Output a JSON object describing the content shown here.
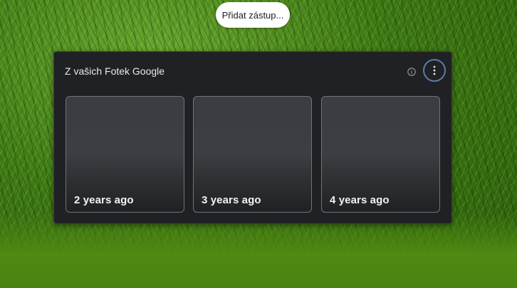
{
  "shortcut": {
    "label": "Přidat zástup..."
  },
  "card": {
    "title": "Z vašich Fotek Google",
    "info_icon": "info-icon",
    "menu_icon": "more-vertical-icon",
    "photos": [
      {
        "label": "2 years ago"
      },
      {
        "label": "3 years ago"
      },
      {
        "label": "4 years ago"
      }
    ]
  },
  "colors": {
    "card_background": "#202124",
    "card_text": "#e8eaed",
    "menu_focus_ring": "#5d7bab",
    "pill_background": "#ffffff"
  }
}
